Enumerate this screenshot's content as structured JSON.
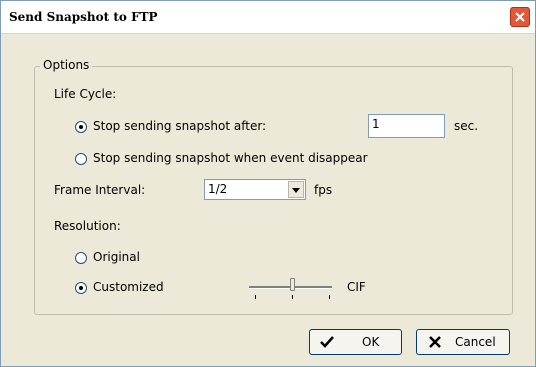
{
  "window": {
    "title": "Send Snapshot to FTP"
  },
  "options": {
    "group_label": "Options",
    "life_cycle": {
      "label": "Life Cycle:",
      "stop_after_label": "Stop sending snapshot after:",
      "stop_after_value": "1",
      "stop_after_unit": "sec.",
      "stop_on_event_label": "Stop sending snapshot when event disappear",
      "selected": "stop_after"
    },
    "frame_interval": {
      "label": "Frame Interval:",
      "value": "1/2",
      "unit": "fps"
    },
    "resolution": {
      "label": "Resolution:",
      "original_label": "Original",
      "customized_label": "Customized",
      "selected": "customized",
      "slider_value_label": "CIF",
      "slider_position": 0.5
    }
  },
  "buttons": {
    "ok_label": "OK",
    "cancel_label": "Cancel"
  },
  "icons": {
    "close": "close-icon",
    "ok": "checkmark-icon",
    "cancel": "x-icon"
  },
  "colors": {
    "close_button": "#e05a3a",
    "button_border": "#003c74"
  }
}
